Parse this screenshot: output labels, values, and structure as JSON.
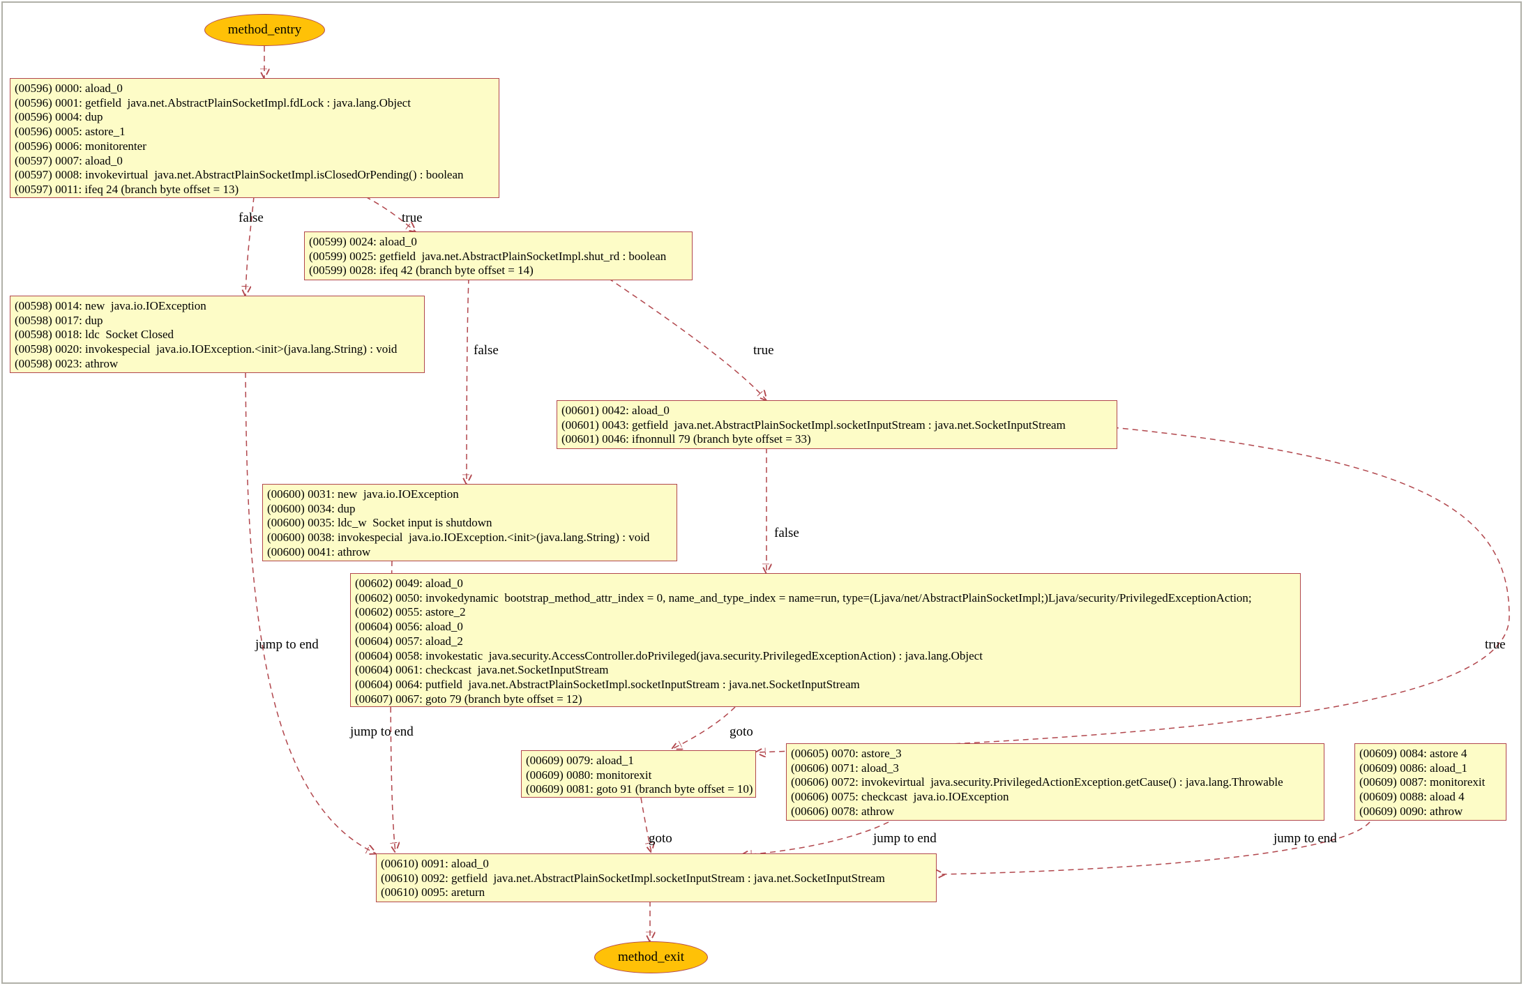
{
  "entry": {
    "label": "method_entry"
  },
  "exit": {
    "label": "method_exit"
  },
  "blocks": {
    "b596": {
      "lines": [
        "(00596) 0000: aload_0",
        "(00596) 0001: getfield  java.net.AbstractPlainSocketImpl.fdLock : java.lang.Object",
        "(00596) 0004: dup",
        "(00596) 0005: astore_1",
        "(00596) 0006: monitorenter",
        "(00597) 0007: aload_0",
        "(00597) 0008: invokevirtual  java.net.AbstractPlainSocketImpl.isClosedOrPending() : boolean",
        "(00597) 0011: ifeq 24 (branch byte offset = 13)"
      ]
    },
    "b599": {
      "lines": [
        "(00599) 0024: aload_0",
        "(00599) 0025: getfield  java.net.AbstractPlainSocketImpl.shut_rd : boolean",
        "(00599) 0028: ifeq 42 (branch byte offset = 14)"
      ]
    },
    "b598": {
      "lines": [
        "(00598) 0014: new  java.io.IOException",
        "(00598) 0017: dup",
        "(00598) 0018: ldc  Socket Closed",
        "(00598) 0020: invokespecial  java.io.IOException.<init>(java.lang.String) : void",
        "(00598) 0023: athrow"
      ]
    },
    "b601": {
      "lines": [
        "(00601) 0042: aload_0",
        "(00601) 0043: getfield  java.net.AbstractPlainSocketImpl.socketInputStream : java.net.SocketInputStream",
        "(00601) 0046: ifnonnull 79 (branch byte offset = 33)"
      ]
    },
    "b600": {
      "lines": [
        "(00600) 0031: new  java.io.IOException",
        "(00600) 0034: dup",
        "(00600) 0035: ldc_w  Socket input is shutdown",
        "(00600) 0038: invokespecial  java.io.IOException.<init>(java.lang.String) : void",
        "(00600) 0041: athrow"
      ]
    },
    "b602": {
      "lines": [
        "(00602) 0049: aload_0",
        "(00602) 0050: invokedynamic  bootstrap_method_attr_index = 0, name_and_type_index = name=run, type=(Ljava/net/AbstractPlainSocketImpl;)Ljava/security/PrivilegedExceptionAction;",
        "(00602) 0055: astore_2",
        "(00604) 0056: aload_0",
        "(00604) 0057: aload_2",
        "(00604) 0058: invokestatic  java.security.AccessController.doPrivileged(java.security.PrivilegedExceptionAction) : java.lang.Object",
        "(00604) 0061: checkcast  java.net.SocketInputStream",
        "(00604) 0064: putfield  java.net.AbstractPlainSocketImpl.socketInputStream : java.net.SocketInputStream",
        "(00607) 0067: goto 79 (branch byte offset = 12)"
      ]
    },
    "b609a": {
      "lines": [
        "(00609) 0079: aload_1",
        "(00609) 0080: monitorexit",
        "(00609) 0081: goto 91 (branch byte offset = 10)"
      ]
    },
    "b605": {
      "lines": [
        "(00605) 0070: astore_3",
        "(00606) 0071: aload_3",
        "(00606) 0072: invokevirtual  java.security.PrivilegedActionException.getCause() : java.lang.Throwable",
        "(00606) 0075: checkcast  java.io.IOException",
        "(00606) 0078: athrow"
      ]
    },
    "b609b": {
      "lines": [
        "(00609) 0084: astore 4",
        "(00609) 0086: aload_1",
        "(00609) 0087: monitorexit",
        "(00609) 0088: aload 4",
        "(00609) 0090: athrow"
      ]
    },
    "b610": {
      "lines": [
        "(00610) 0091: aload_0",
        "(00610) 0092: getfield  java.net.AbstractPlainSocketImpl.socketInputStream : java.net.SocketInputStream",
        "(00610) 0095: areturn"
      ]
    }
  },
  "edgeLabels": {
    "e1_false": "false",
    "e1_true": "true",
    "e2_false": "false",
    "e2_true": "true",
    "e598_end": "jump to end",
    "e601_false": "false",
    "e601_true": "true",
    "e600_end": "jump to end",
    "e602_goto": "goto",
    "e609_goto": "goto",
    "e605_end": "jump to end",
    "e609b_end": "jump to end"
  }
}
